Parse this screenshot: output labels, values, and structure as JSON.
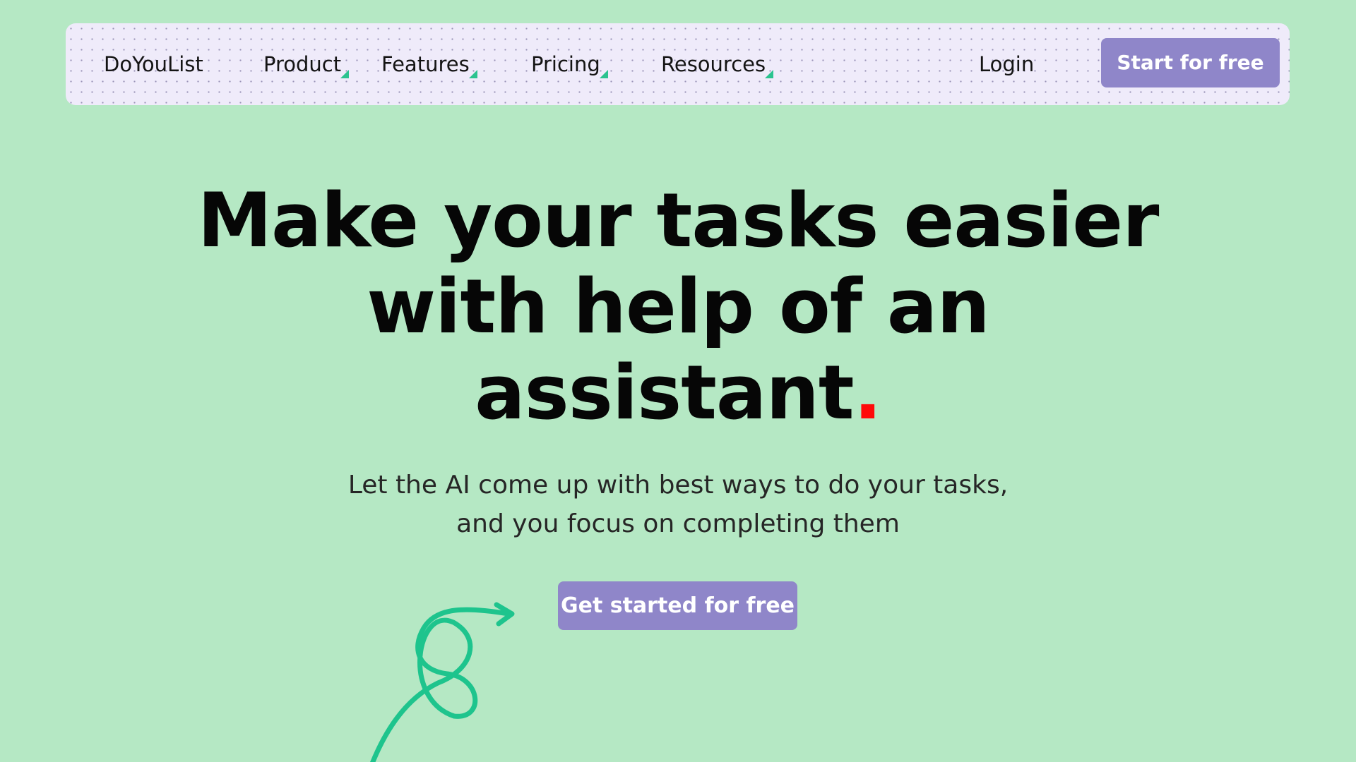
{
  "nav": {
    "brand": "DoYouList",
    "items": [
      {
        "label": "Product"
      },
      {
        "label": "Features"
      },
      {
        "label": "Pricing"
      },
      {
        "label": "Resources"
      }
    ],
    "login": "Login",
    "start_button": "Start for free"
  },
  "hero": {
    "headline_lines": [
      "Make your tasks easier",
      "with help of an",
      "assistant"
    ],
    "headline_dot": ".",
    "subtitle_lines": [
      "Let the AI come up with best ways to do your tasks,",
      "and you focus on completing them"
    ],
    "cta_button": "Get started for free"
  },
  "colors": {
    "background": "#b5e8c4",
    "nav_background": "#efebfa",
    "button": "#8f86c9",
    "accent_green": "#2bc38f",
    "dot_red": "#ff0a0a"
  }
}
